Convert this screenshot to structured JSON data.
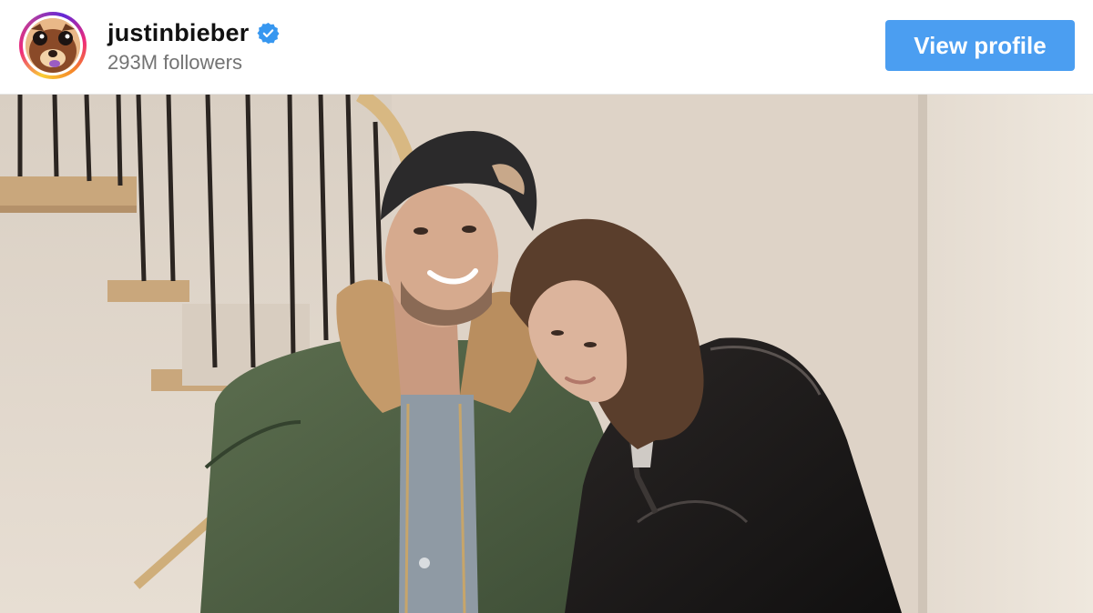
{
  "header": {
    "username": "justinbieber",
    "verified": true,
    "followers_text": "293M followers",
    "view_profile_label": "View profile"
  },
  "colors": {
    "button_bg": "#4b9ef1",
    "verified_badge": "#3797f0",
    "username_text": "#111111",
    "followers_text": "#737373"
  },
  "photo": {
    "description_icon": "photo-post-image"
  }
}
